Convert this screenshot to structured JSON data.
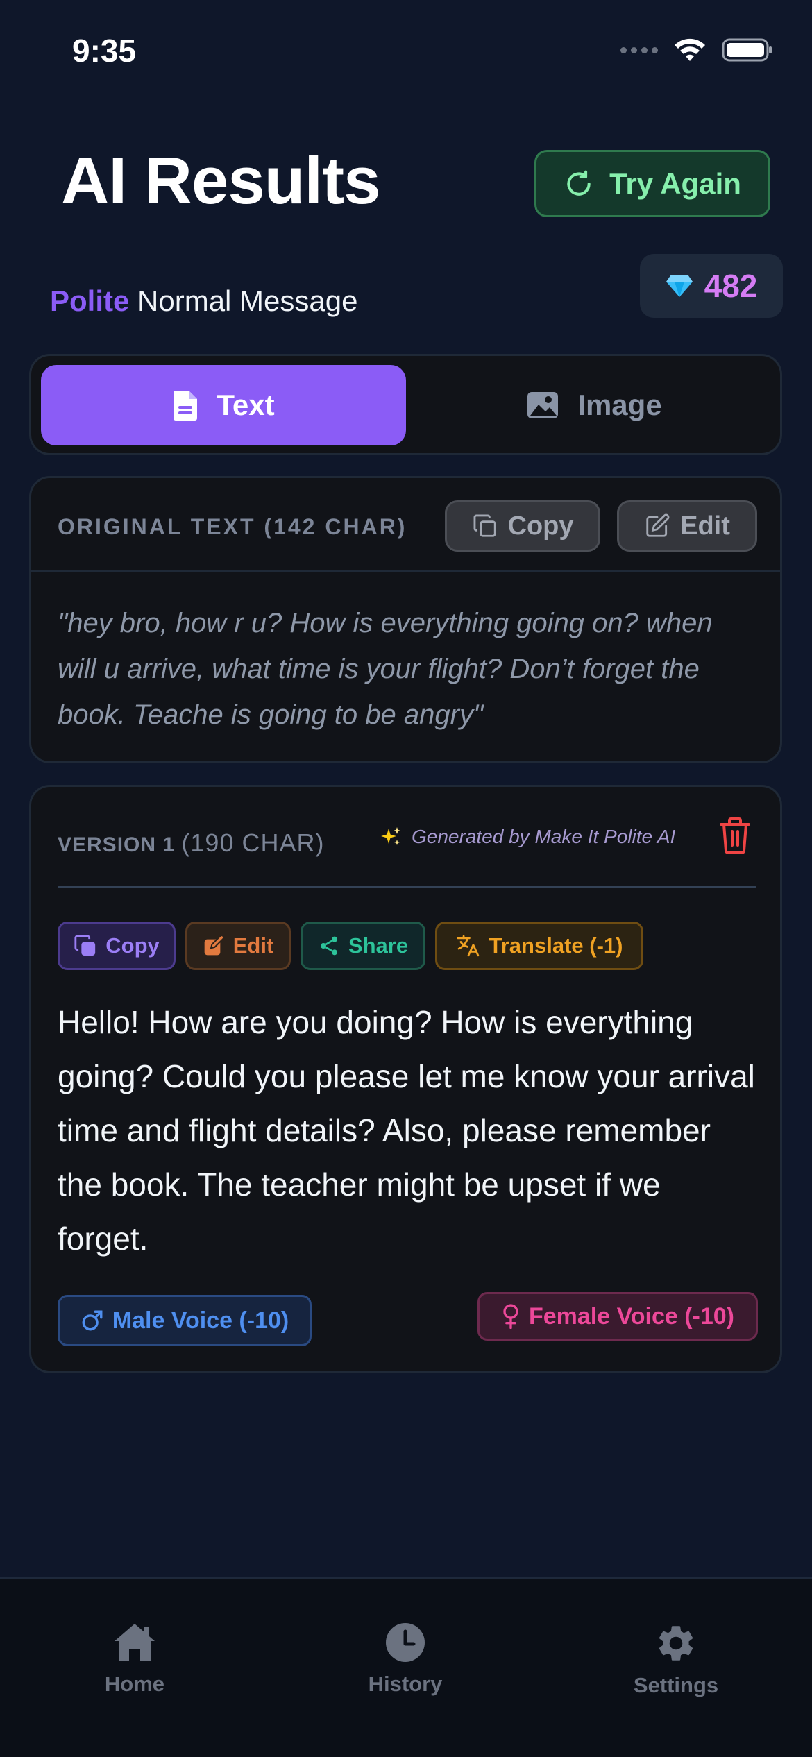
{
  "status_bar": {
    "time": "9:35"
  },
  "header": {
    "title": "AI Results",
    "try_again_label": "Try Again"
  },
  "subtitle": {
    "tone": "Polite",
    "message_type": "Normal Message"
  },
  "gems": {
    "count": "482",
    "icon": "gem-icon"
  },
  "tabs": [
    {
      "label": "Text",
      "icon": "document-icon",
      "active": true
    },
    {
      "label": "Image",
      "icon": "image-icon",
      "active": false
    }
  ],
  "original": {
    "label": "ORIGINAL TEXT (142 CHAR)",
    "copy_label": "Copy",
    "edit_label": "Edit",
    "text": "\"hey bro, how r u? How is everything going on? when will u arrive, what time is your flight? Don’t forget the book. Teache is going to be angry\""
  },
  "version": {
    "label": "VERSION 1",
    "chars": "(190 CHAR)",
    "generated_by": "Generated by Make It Polite AI",
    "actions": {
      "copy": "Copy",
      "edit": "Edit",
      "share": "Share",
      "translate": "Translate (-1)"
    },
    "text": "Hello! How are you doing? How is everything going? Could you please let me know your arrival time and flight details? Also, please remember the book. The teacher might be upset if we forget.",
    "male_voice": "Male Voice (-10)",
    "female_voice": "Female Voice (-10)"
  },
  "nav": [
    {
      "label": "Home",
      "icon": "home-icon"
    },
    {
      "label": "History",
      "icon": "clock-icon"
    },
    {
      "label": "Settings",
      "icon": "gear-icon"
    }
  ],
  "colors": {
    "background": "#0f172a",
    "accent": "#8b5cf6",
    "success": "#86efac",
    "danger": "#ef4444",
    "gem": "#d57cf4"
  }
}
